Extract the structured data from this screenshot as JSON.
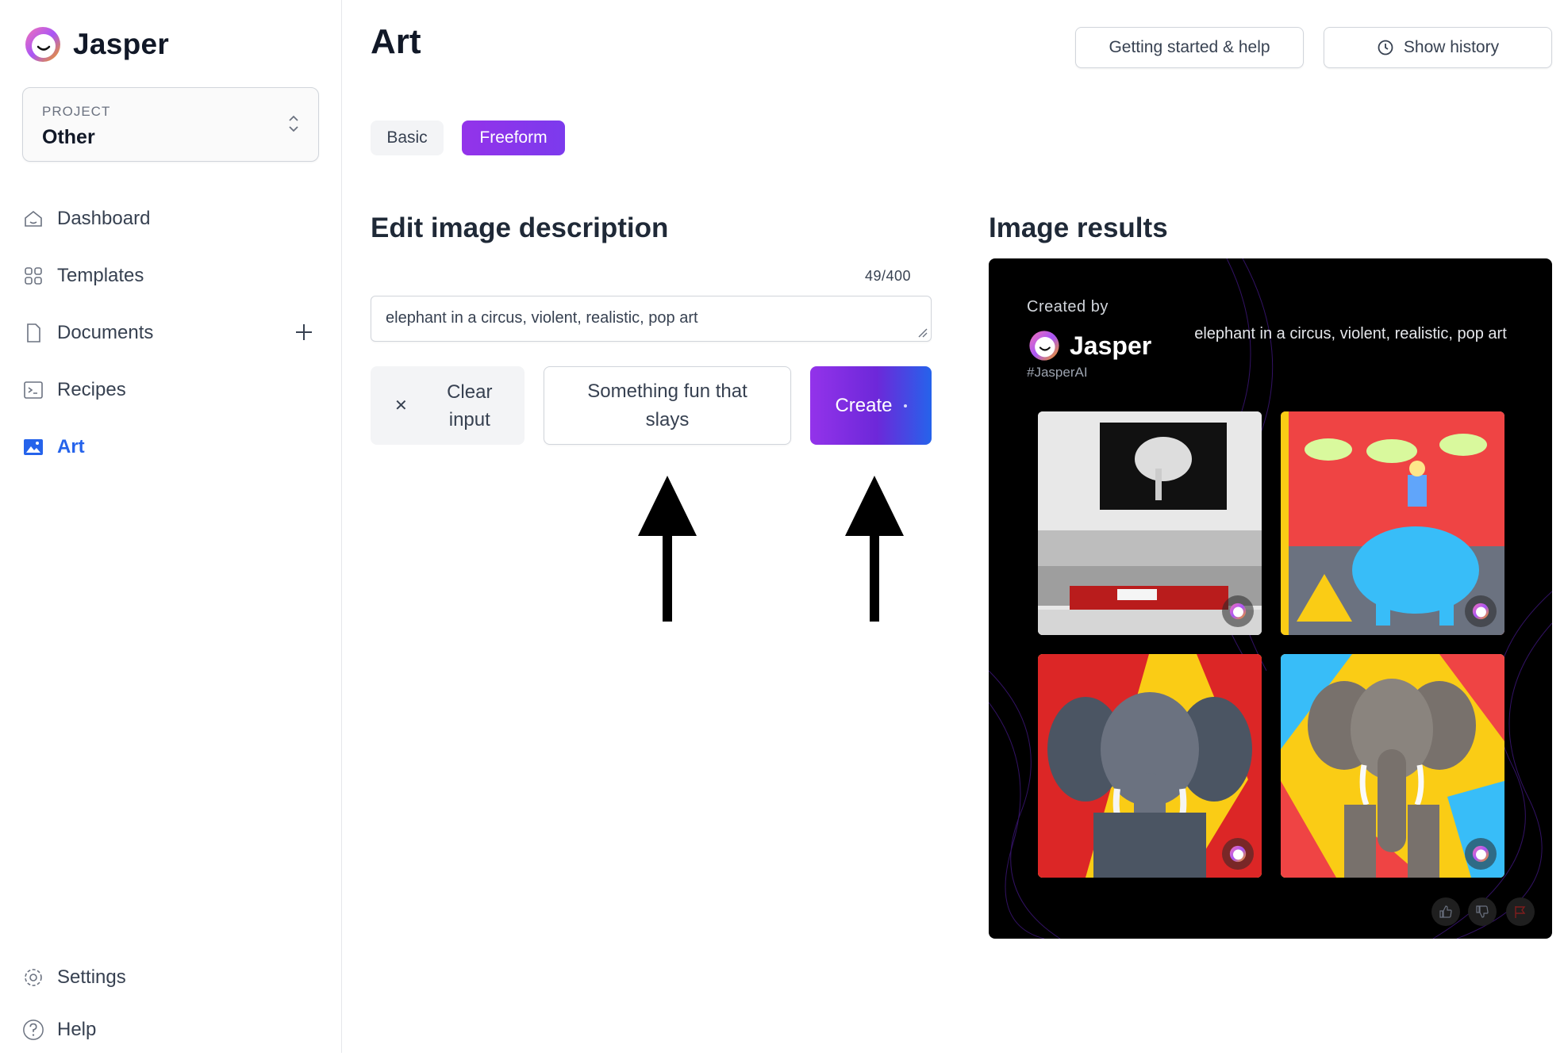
{
  "app": {
    "name": "Jasper"
  },
  "project": {
    "label": "PROJECT",
    "value": "Other"
  },
  "nav": {
    "items": [
      {
        "label": "Dashboard",
        "icon": "home-icon"
      },
      {
        "label": "Templates",
        "icon": "grid-icon"
      },
      {
        "label": "Documents",
        "icon": "document-icon"
      },
      {
        "label": "Recipes",
        "icon": "terminal-icon"
      },
      {
        "label": "Art",
        "icon": "image-icon",
        "active": true
      }
    ],
    "bottom": [
      {
        "label": "Settings",
        "icon": "gear-icon"
      },
      {
        "label": "Help",
        "icon": "question-icon"
      }
    ]
  },
  "page": {
    "title": "Art"
  },
  "header": {
    "help_label": "Getting started & help",
    "history_label": "Show history"
  },
  "tabs": [
    {
      "label": "Basic"
    },
    {
      "label": "Freeform",
      "active": true
    }
  ],
  "editor": {
    "title": "Edit image description",
    "counter": "49/400",
    "value": "elephant in a circus, violent, realistic, pop art",
    "clear_label": "Clear input",
    "fun_label": "Something fun that slays",
    "create_label": "Create"
  },
  "results": {
    "title": "Image results",
    "created_by": "Created by",
    "brand": "Jasper",
    "hashtag": "#JasperAI",
    "prompt": "elephant in a circus, violent, realistic, pop art"
  },
  "colors": {
    "accent": "#2563eb",
    "purple": "#9333ea",
    "card_bg": "#000000"
  }
}
